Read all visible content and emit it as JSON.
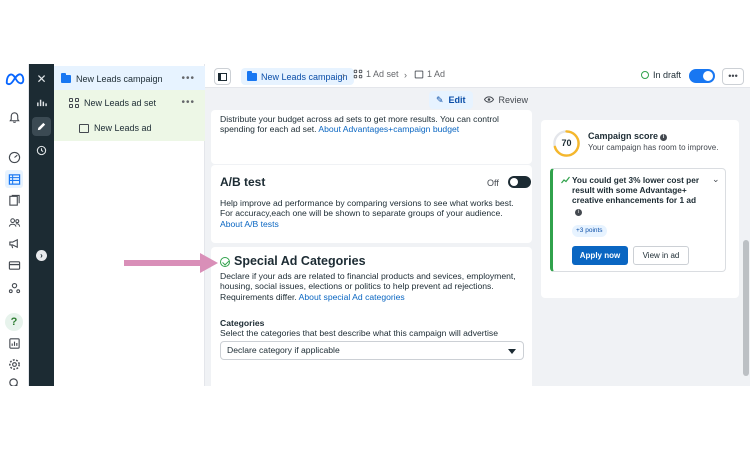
{
  "icons": {
    "meta": "meta-logo",
    "rail": [
      "notifications-icon",
      "dashboard-icon",
      "table-icon",
      "pages-icon",
      "audience-icon",
      "megaphone-icon",
      "billing-icon",
      "accounts-center-icon",
      "help-icon",
      "reports-icon",
      "settings-icon",
      "search-icon"
    ],
    "strip": [
      "close-icon",
      "chart-icon",
      "edit-icon",
      "history-icon",
      "info-icon"
    ]
  },
  "tree": {
    "campaign": "New Leads campaign",
    "adset": "New Leads ad set",
    "ad": "New Leads ad",
    "more": "•••"
  },
  "header": {
    "crumb_campaign": "New Leads campaign",
    "crumb_adset": "1 Ad set",
    "crumb_ad": "1 Ad",
    "status": "In draft",
    "more": "•••"
  },
  "modes": {
    "edit": "Edit",
    "review": "Review"
  },
  "budget_card": {
    "text": "Distribute your budget across ad sets to get more results. You can control spending for each ad set. ",
    "link": "About Advantages+campaign budget"
  },
  "ab_card": {
    "title": "A/B test",
    "toggle_label": "Off",
    "text": "Help improve ad performance by comparing versions to see what works best. For accuracy,each one will be shown to separate groups of your audience. ",
    "link": "About A/B tests"
  },
  "special_card": {
    "title": "Special Ad Categories",
    "text": "Declare if your ads are related to financial products and sevices, employment, housing, social issues, elections or politics to help prevent ad rejections. Requirements differ. ",
    "link": "About special Ad categories",
    "categories_label": "Categories",
    "categories_sub": "Select the categories that best describe what this campaign will advertise",
    "select_value": "Declare category if applicable"
  },
  "score": {
    "value": "70",
    "level": 0.7,
    "title": "Campaign score",
    "subtitle": "Your campaign has room to improve.",
    "rec_text": "You could get 3% lower cost per result with some Advantage+ creative enhancements for 1 ad",
    "points": "+3 points",
    "apply": "Apply now",
    "view": "View in ad"
  },
  "colors": {
    "accent": "#1877f2",
    "button": "#0a66c2",
    "success": "#31a24c",
    "gauge": "#f5b72c",
    "arrow": "#d98fb8",
    "sidebar_dark": "#1c2b33"
  }
}
